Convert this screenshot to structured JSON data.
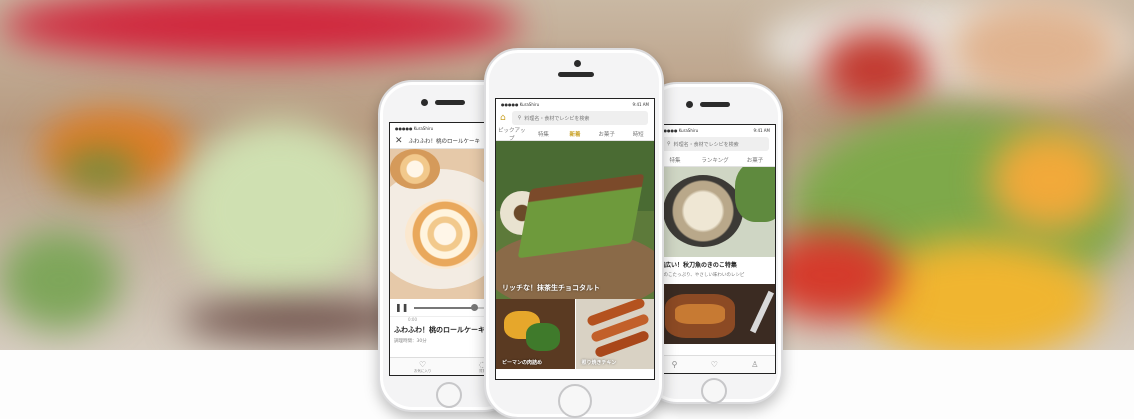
{
  "left_phone": {
    "status_left": "●●●●● KuraShiru",
    "status_time": "9:41 AM",
    "header_title": "ふわふわ！桃のロールケーキ",
    "video_time": "0:00",
    "recipe_title": "ふわふわ！桃のロールケーキ",
    "recipe_meta": "調理時間：30分",
    "tab_favorite": "お気に入り",
    "tab_question": "質問"
  },
  "center_phone": {
    "status_left": "●●●●● KuraShiru",
    "status_time": "9:41 AM",
    "search_placeholder": "料理名・食材でレシピを検索",
    "tabs": [
      "ピックアップ",
      "特集",
      "新着",
      "お菓子",
      "時短"
    ],
    "hero_caption": "リッチな！抹茶生チョコタルト",
    "card1_caption": "ピーマンの肉詰め",
    "card2_caption": "照り焼きチキン"
  },
  "right_phone": {
    "status_left": "●●●●● KuraShiru",
    "status_time": "9:41 AM",
    "search_placeholder": "料理名・食材でレシピを検索",
    "tabs": [
      "特集",
      "ランキング",
      "お菓子"
    ],
    "card_title": "幅広い！秋刀魚のきのこ特集",
    "card_desc": "きのこたっぷり、やさしい味わいのレシピ"
  },
  "colors": {
    "accent": "#c9a227",
    "matcha": "#6e9a3c",
    "cocoa": "#7b4a2a"
  }
}
